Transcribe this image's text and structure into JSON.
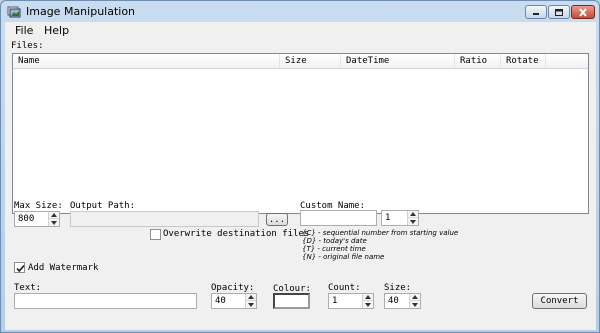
{
  "window": {
    "title": "Image Manipulation"
  },
  "menu": {
    "file": "File",
    "help": "Help"
  },
  "files": {
    "label": "Files:",
    "columns": [
      "Name",
      "Size",
      "DateTime",
      "Ratio",
      "Rotate"
    ],
    "rows": []
  },
  "output": {
    "max_size_label": "Max Size:",
    "max_size_value": "800",
    "output_path_label": "Output Path:",
    "output_path_value": "",
    "browse_label": "...",
    "overwrite_label": "Overwrite destination files",
    "overwrite_checked": false
  },
  "custom_name": {
    "label": "Custom Name:",
    "value": "",
    "counter_value": "1",
    "help": [
      "{C} - sequential number from starting value",
      "{D} - today's date",
      "{T} - current time",
      "{N} - original file name"
    ]
  },
  "watermark": {
    "add_label": "Add Watermark",
    "add_checked": true,
    "text_label": "Text:",
    "text_value": "",
    "opacity_label": "Opacity:",
    "opacity_value": "40",
    "colour_label": "Colour:",
    "colour_value": "#ffffff",
    "count_label": "Count:",
    "count_value": "1",
    "size_label": "Size:",
    "size_value": "40"
  },
  "actions": {
    "convert_label": "Convert"
  }
}
